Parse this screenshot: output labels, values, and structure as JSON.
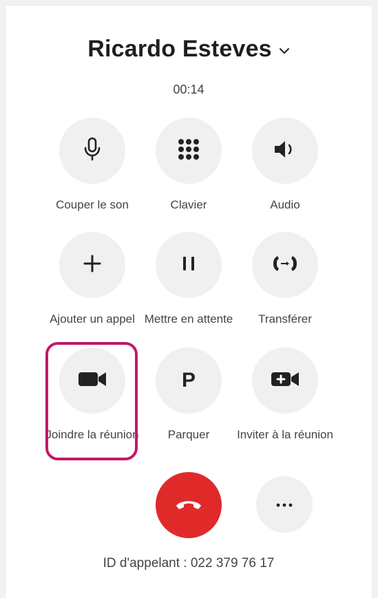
{
  "call": {
    "contact_name": "Ricardo Esteves",
    "duration": "00:14",
    "caller_id": "ID d'appelant : 022 379 76 17"
  },
  "buttons": [
    {
      "id": "mute",
      "label": "Couper le son",
      "icon": "microphone-icon"
    },
    {
      "id": "keypad",
      "label": "Clavier",
      "icon": "keypad-icon"
    },
    {
      "id": "audio",
      "label": "Audio",
      "icon": "speaker-icon"
    },
    {
      "id": "add-call",
      "label": "Ajouter un appel",
      "icon": "plus-icon"
    },
    {
      "id": "hold",
      "label": "Mettre en attente",
      "icon": "pause-icon"
    },
    {
      "id": "transfer",
      "label": "Transférer",
      "icon": "transfer-icon"
    },
    {
      "id": "join-meeting",
      "label": "Joindre la réunion",
      "icon": "video-camera-icon"
    },
    {
      "id": "park",
      "label": "Parquer",
      "icon": "park-icon",
      "glyph": "P"
    },
    {
      "id": "invite-meeting",
      "label": "Inviter à la réunion",
      "icon": "video-plus-icon"
    }
  ],
  "end_call": {
    "icon": "hang-up-icon",
    "color": "#e02a2a"
  },
  "more_options": {
    "icon": "ellipsis-icon"
  },
  "colors": {
    "highlight": "#c2186a",
    "button_bg": "#f0f0f0",
    "text": "#444444"
  }
}
